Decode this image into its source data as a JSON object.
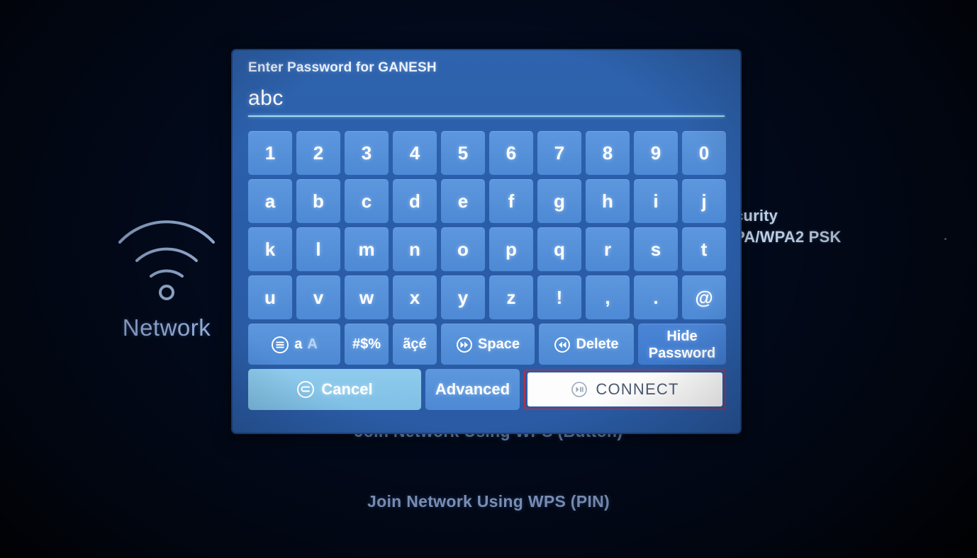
{
  "background": {
    "network_label": "Network",
    "wifi_icon": "wifi-icon",
    "security_label": "curity",
    "security_value": "PA/WPA2 PSK",
    "wps_button": "Join Network Using WPS (Button)",
    "wps_pin": "Join Network Using WPS (PIN)"
  },
  "dialog": {
    "title": "Enter Password for GANESH",
    "password_value": "abc",
    "keyboard": {
      "rows": [
        [
          "1",
          "2",
          "3",
          "4",
          "5",
          "6",
          "7",
          "8",
          "9",
          "0"
        ],
        [
          "a",
          "b",
          "c",
          "d",
          "e",
          "f",
          "g",
          "h",
          "i",
          "j"
        ],
        [
          "k",
          "l",
          "m",
          "n",
          "o",
          "p",
          "q",
          "r",
          "s",
          "t"
        ],
        [
          "u",
          "v",
          "w",
          "x",
          "y",
          "z",
          "!",
          ",",
          ".",
          "@"
        ]
      ],
      "function_keys": {
        "case_toggle_lower": "a",
        "case_toggle_upper": "A",
        "case_toggle_icon": "list-circle-icon",
        "symbols": "#$%",
        "accents": "ãçé",
        "space": "Space",
        "space_icon": "fast-forward-circle-icon",
        "delete": "Delete",
        "delete_icon": "rewind-circle-icon",
        "hide_password_line1": "Hide",
        "hide_password_line2": "Password"
      }
    },
    "actions": {
      "cancel": "Cancel",
      "cancel_icon": "return-circle-icon",
      "advanced": "Advanced",
      "connect": "CONNECT",
      "connect_icon": "play-pause-circle-icon"
    }
  },
  "colors": {
    "dialog_bg": "#2a5da8",
    "key_bg": "#4d89d5",
    "cancel_bg": "#7fc0e6",
    "connect_bg": "#fdfdfd",
    "highlight_border": "#b03048",
    "underline": "#9fdcf3",
    "screen_bg": "#02143c"
  }
}
